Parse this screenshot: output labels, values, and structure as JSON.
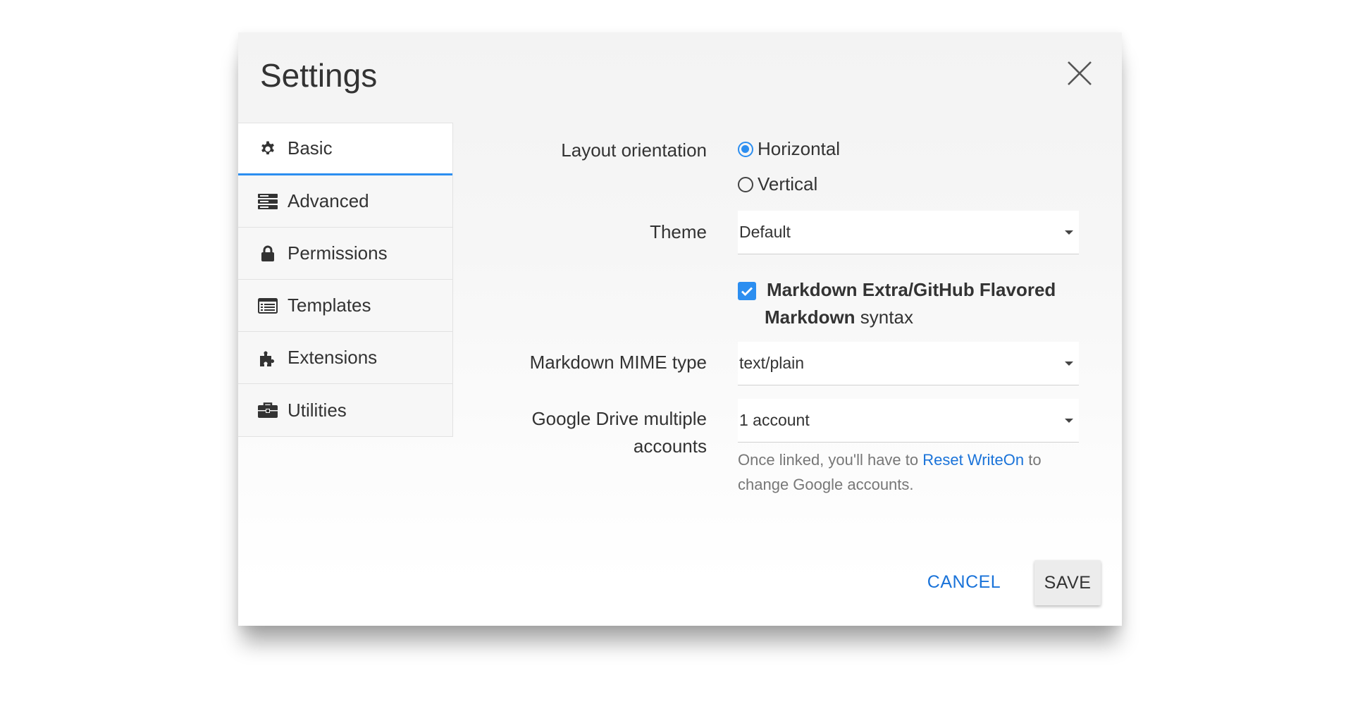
{
  "dialog": {
    "title": "Settings",
    "close_icon": "close-icon"
  },
  "sidebar": {
    "items": [
      {
        "label": "Basic",
        "icon": "gear-icon",
        "active": true
      },
      {
        "label": "Advanced",
        "icon": "server-icon",
        "active": false
      },
      {
        "label": "Permissions",
        "icon": "lock-icon",
        "active": false
      },
      {
        "label": "Templates",
        "icon": "list-icon",
        "active": false
      },
      {
        "label": "Extensions",
        "icon": "puzzle-icon",
        "active": false
      },
      {
        "label": "Utilities",
        "icon": "briefcase-icon",
        "active": false
      }
    ]
  },
  "form": {
    "layout_orientation": {
      "label": "Layout orientation",
      "options": [
        "Horizontal",
        "Vertical"
      ],
      "selected": "Horizontal"
    },
    "theme": {
      "label": "Theme",
      "value": "Default"
    },
    "markdown_extra": {
      "checked": true,
      "bold_part1": "Markdown Extra/GitHub Flavored",
      "bold_part2": "Markdown",
      "rest": " syntax"
    },
    "mime_type": {
      "label": "Markdown MIME type",
      "value": "text/plain"
    },
    "google_drive": {
      "label_line1": "Google Drive multiple",
      "label_line2": "accounts",
      "value": "1 account",
      "help_before": "Once linked, you'll have to ",
      "help_link": "Reset WriteOn",
      "help_after": " to change Google accounts."
    }
  },
  "footer": {
    "cancel_label": "CANCEL",
    "save_label": "SAVE"
  },
  "colors": {
    "accent": "#2c8ef0",
    "link": "#1a73d9"
  }
}
